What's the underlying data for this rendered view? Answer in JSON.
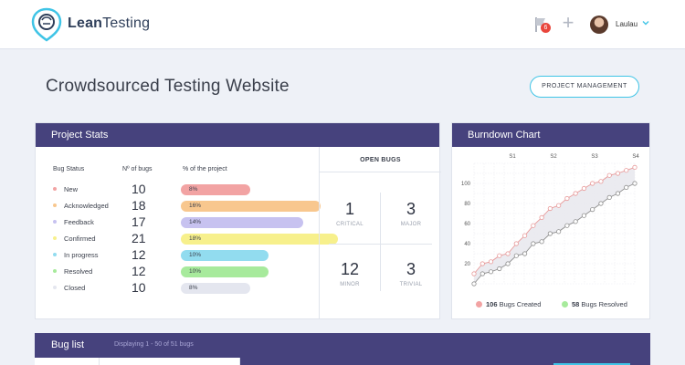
{
  "app": {
    "brand_bold": "Lean",
    "brand_rest": "Testing"
  },
  "header": {
    "notification_count": "6",
    "user_name": "Laulau"
  },
  "page": {
    "title": "Crowdsourced Testing Website",
    "pm_button": "PROJECT MANAGEMENT"
  },
  "stats": {
    "title": "Project Stats",
    "columns": {
      "status": "Bug Status",
      "count": "Nº of bugs",
      "pct": "% of the project"
    },
    "rows": [
      {
        "status": "New",
        "count": "10",
        "pct": "8%",
        "fraction": 0.08,
        "color": "#f2a3a3"
      },
      {
        "status": "Acknowledged",
        "count": "18",
        "pct": "16%",
        "fraction": 0.16,
        "color": "#f8c78e"
      },
      {
        "status": "Feedback",
        "count": "17",
        "pct": "14%",
        "fraction": 0.14,
        "color": "#c7c2f0"
      },
      {
        "status": "Confirmed",
        "count": "21",
        "pct": "18%",
        "fraction": 0.18,
        "color": "#f7f08c"
      },
      {
        "status": "In progress",
        "count": "12",
        "pct": "10%",
        "fraction": 0.1,
        "color": "#92dcef"
      },
      {
        "status": "Resolved",
        "count": "12",
        "pct": "10%",
        "fraction": 0.1,
        "color": "#a7ea9c"
      },
      {
        "status": "Closed",
        "count": "10",
        "pct": "8%",
        "fraction": 0.08,
        "color": "#e4e6ef"
      }
    ],
    "open_bugs": {
      "title": "OPEN BUGS",
      "critical": {
        "value": "1",
        "label": "CRITICAL"
      },
      "major": {
        "value": "3",
        "label": "MAJOR"
      },
      "minor": {
        "value": "12",
        "label": "MINOR"
      },
      "trivial": {
        "value": "3",
        "label": "TRIVIAL"
      }
    }
  },
  "burndown": {
    "title": "Burndown Chart",
    "legend_created_value": "106",
    "legend_created_text": " Bugs Created",
    "legend_resolved_value": "58",
    "legend_resolved_text": " Bugs Resolved",
    "created_color": "#f2a3a3",
    "resolved_color": "#a7ea9c"
  },
  "chart_data": {
    "type": "line",
    "title": "Burndown Chart",
    "x_top_labels": [
      "S1",
      "S2",
      "S3",
      "S4"
    ],
    "y_ticks": [
      20,
      40,
      60,
      80,
      100
    ],
    "ylim": [
      0,
      120
    ],
    "points_count": 20,
    "series": [
      {
        "name": "Bugs Created",
        "color": "#e89a9a",
        "values": [
          10,
          20,
          22,
          28,
          30,
          40,
          48,
          58,
          66,
          75,
          78,
          85,
          90,
          95,
          100,
          102,
          108,
          110,
          113,
          116
        ]
      },
      {
        "name": "Bugs Resolved",
        "color": "#8f8f8f",
        "values": [
          0,
          10,
          12,
          15,
          20,
          28,
          30,
          40,
          42,
          50,
          52,
          58,
          62,
          68,
          74,
          80,
          86,
          90,
          96,
          100
        ]
      }
    ],
    "grid": true
  },
  "buglist": {
    "title": "Bug list",
    "subtitle": "Displaying 1 - 50 of 51 bugs"
  }
}
